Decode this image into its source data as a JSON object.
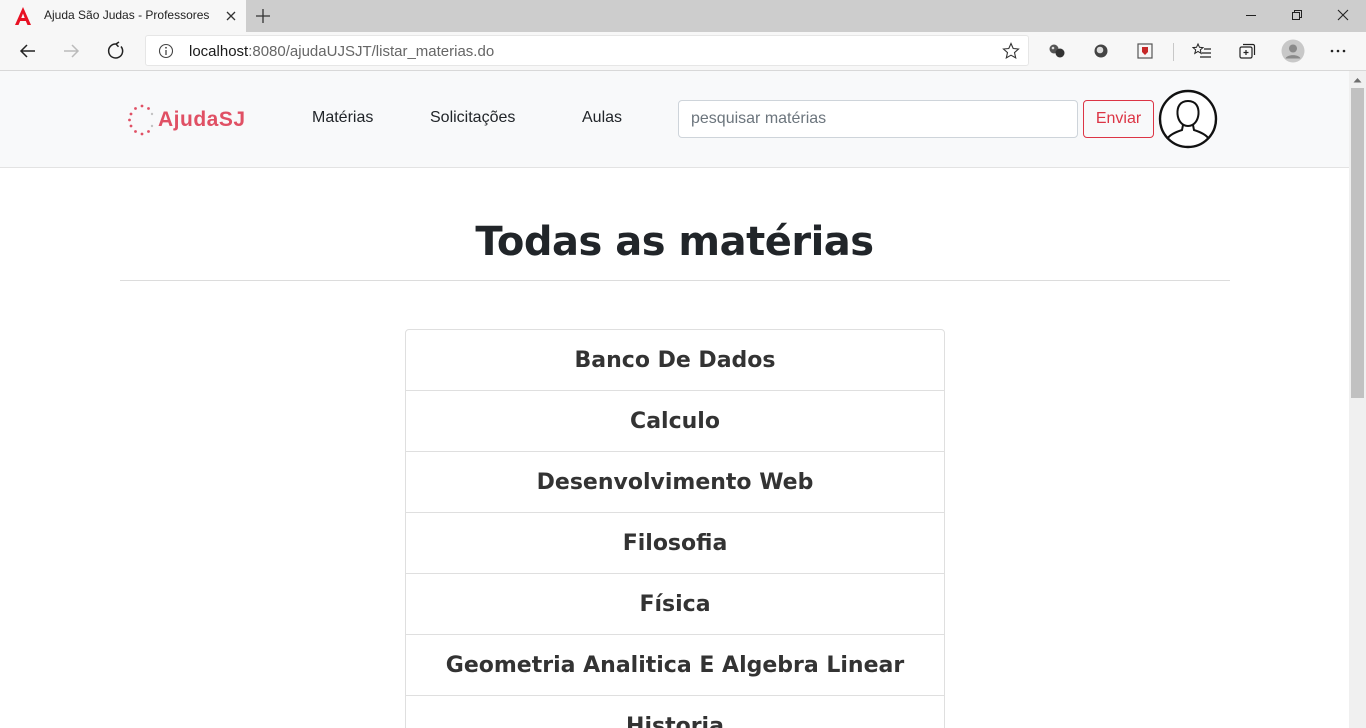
{
  "browser": {
    "tab_title": "Ajuda São Judas - Professores",
    "url_host": "localhost",
    "url_rest": ":8080/ajudaUJSJT/listar_materias.do"
  },
  "navbar": {
    "brand": "AjudaSJ",
    "links": [
      "Matérias",
      "Solicitações",
      "Aulas"
    ],
    "search_placeholder": "pesquisar matérias",
    "search_value": "",
    "submit_label": "Enviar"
  },
  "main": {
    "title": "Todas as matérias",
    "subjects": [
      "Banco De Dados",
      "Calculo",
      "Desenvolvimento Web",
      "Filosofia",
      "Física",
      "Geometria Analitica E Algebra Linear",
      "Historia"
    ]
  },
  "colors": {
    "brand": "#e05064",
    "danger": "#dc3545",
    "tab_favicon": "#e81123"
  }
}
